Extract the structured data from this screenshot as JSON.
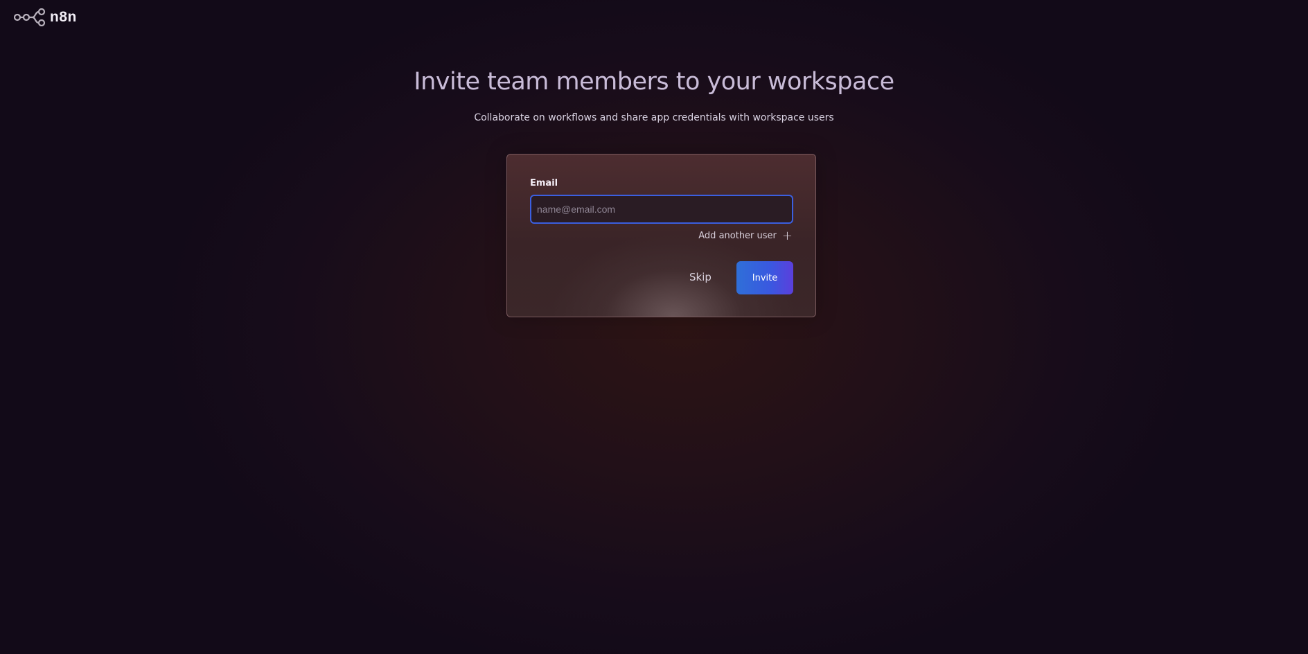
{
  "app": {
    "logo_text": "n8n"
  },
  "page": {
    "title": "Invite team members to your workspace",
    "subtitle": "Collaborate on workflows and share app credentials with workspace users"
  },
  "form": {
    "email_label": "Email",
    "email_value": "",
    "email_placeholder": "name@email.com",
    "add_user_label": "Add another user",
    "skip_label": "Skip",
    "invite_label": "Invite"
  },
  "colors": {
    "accent": "#3b5fe0",
    "invite_gradient_start": "#2f6fd8",
    "invite_gradient_end": "#5b3fdc"
  },
  "icons": {
    "logo": "n8n-logo-icon",
    "add": "plus-icon"
  }
}
